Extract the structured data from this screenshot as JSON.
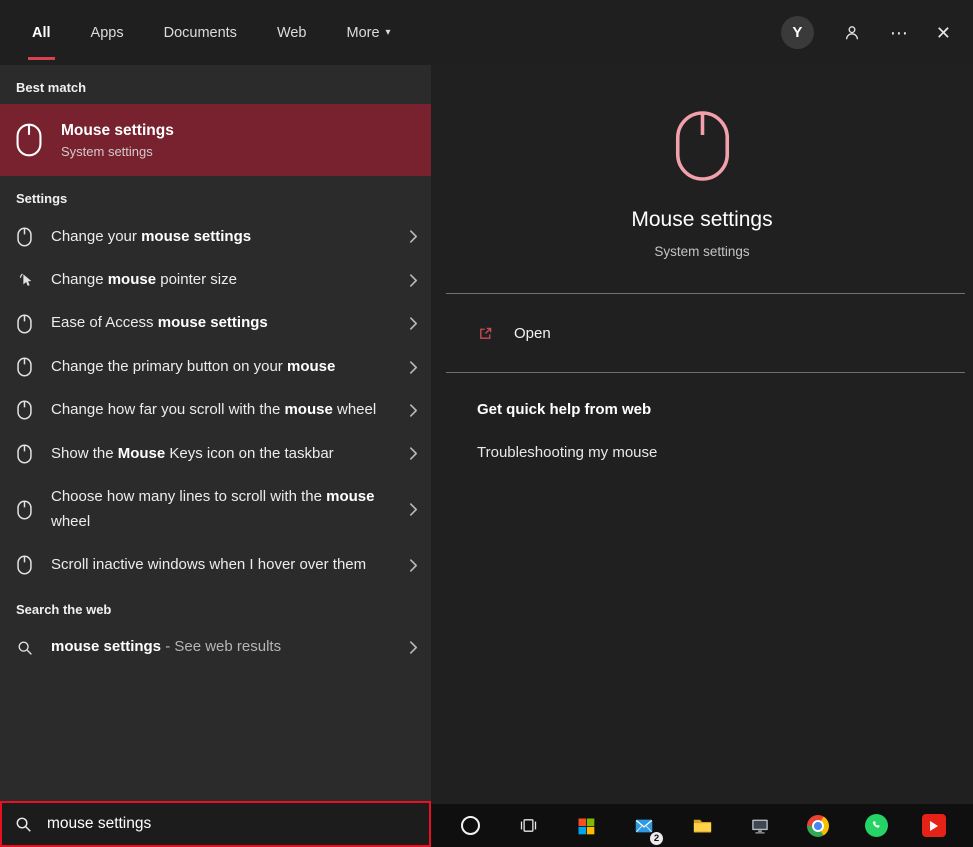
{
  "topbar": {
    "tabs": [
      {
        "label": "All",
        "active": true
      },
      {
        "label": "Apps",
        "active": false
      },
      {
        "label": "Documents",
        "active": false
      },
      {
        "label": "Web",
        "active": false
      },
      {
        "label": "More",
        "active": false,
        "dropdown": true
      }
    ],
    "avatar_initial": "Y"
  },
  "icons": {
    "more_options": "⋯",
    "close": "✕",
    "dropdown_caret": "▾"
  },
  "left_panel": {
    "best_match_header": "Best match",
    "best_match": {
      "title": "Mouse settings",
      "subtitle": "System settings"
    },
    "settings_header": "Settings",
    "settings_items": [
      {
        "icon": "mouse",
        "parts": [
          {
            "t": "Change your ",
            "b": false
          },
          {
            "t": "mouse settings",
            "b": true
          }
        ]
      },
      {
        "icon": "pointer",
        "parts": [
          {
            "t": "Change ",
            "b": false
          },
          {
            "t": "mouse",
            "b": true
          },
          {
            "t": " pointer size",
            "b": false
          }
        ]
      },
      {
        "icon": "mouse",
        "parts": [
          {
            "t": "Ease of Access ",
            "b": false
          },
          {
            "t": "mouse settings",
            "b": true
          }
        ]
      },
      {
        "icon": "mouse",
        "parts": [
          {
            "t": "Change the primary button on your ",
            "b": false
          },
          {
            "t": "mouse",
            "b": true
          }
        ]
      },
      {
        "icon": "mouse",
        "parts": [
          {
            "t": "Change how far you scroll with the ",
            "b": false
          },
          {
            "t": "mouse",
            "b": true
          },
          {
            "t": " wheel",
            "b": false
          }
        ]
      },
      {
        "icon": "mouse",
        "parts": [
          {
            "t": "Show the ",
            "b": false
          },
          {
            "t": "Mouse",
            "b": true
          },
          {
            "t": " Keys icon on the taskbar",
            "b": false
          }
        ]
      },
      {
        "icon": "mouse",
        "parts": [
          {
            "t": "Choose how many lines to scroll with the ",
            "b": false
          },
          {
            "t": "mouse",
            "b": true
          },
          {
            "t": " wheel",
            "b": false
          }
        ]
      },
      {
        "icon": "mouse",
        "parts": [
          {
            "t": "Scroll inactive windows when I hover over them",
            "b": false
          }
        ]
      }
    ],
    "web_header": "Search the web",
    "web_item_parts": [
      {
        "t": "mouse settings",
        "b": true
      },
      {
        "t": " - See web results",
        "b": false,
        "dim": true
      }
    ]
  },
  "search_box": {
    "value": "mouse settings"
  },
  "preview": {
    "title": "Mouse settings",
    "subtitle": "System settings",
    "open_label": "Open",
    "help_header": "Get quick help from web",
    "help_link": "Troubleshooting my mouse"
  },
  "taskbar": {
    "mail_badge": "2",
    "apps": [
      "cortana",
      "task-view",
      "microsoft-store",
      "mail",
      "file-explorer",
      "computer",
      "chrome",
      "whatsapp",
      "youtube"
    ]
  },
  "colors": {
    "bg-top": "#1f1f1f",
    "bg-left": "#2b2b2b",
    "bg-right": "#202020",
    "best-bg": "#78222f",
    "underline": "#d6424f",
    "accent-pink": "#f2a0ab",
    "open-icon": "#c84c55",
    "search-border": "#e81123",
    "taskbar-bg": "#0f0f0f",
    "divider": "#707070",
    "text-secondary": "#c5c5c5"
  }
}
